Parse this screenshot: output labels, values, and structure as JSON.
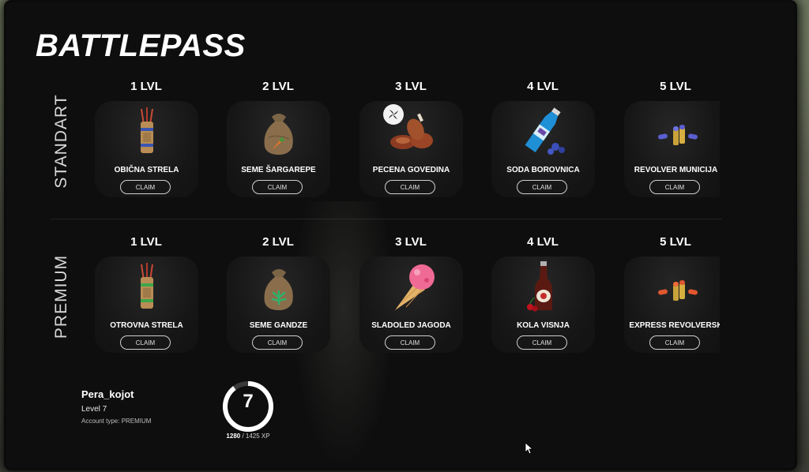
{
  "title": "BATTLEPASS",
  "rows": {
    "standart": {
      "label": "STANDART",
      "items": [
        {
          "level": "1 LVL",
          "name": "OBIČNA STRELA",
          "claim": "CLAIM",
          "icon": "arrow-quiver-icon"
        },
        {
          "level": "2 LVL",
          "name": "SEME ŠARGAREPE",
          "claim": "CLAIM",
          "icon": "carrot-seed-bag-icon"
        },
        {
          "level": "3 LVL",
          "name": "PECENA GOVEDINA",
          "claim": "CLAIM",
          "icon": "roast-meat-icon"
        },
        {
          "level": "4 LVL",
          "name": "SODA BOROVNICA",
          "claim": "CLAIM",
          "icon": "blueberry-soda-icon"
        },
        {
          "level": "5 LVL",
          "name": "REVOLVER MUNICIJA",
          "claim": "CLAIM",
          "icon": "revolver-ammo-icon"
        }
      ]
    },
    "premium": {
      "label": "PREMIUM",
      "items": [
        {
          "level": "1 LVL",
          "name": "OTROVNA STRELA",
          "claim": "CLAIM",
          "icon": "poison-arrow-quiver-icon"
        },
        {
          "level": "2 LVL",
          "name": "SEME GANDZE",
          "claim": "CLAIM",
          "icon": "cannabis-seed-bag-icon"
        },
        {
          "level": "3 LVL",
          "name": "SLADOLED JAGODA",
          "claim": "CLAIM",
          "icon": "strawberry-ice-cream-icon"
        },
        {
          "level": "4 LVL",
          "name": "KOLA VISNJA",
          "claim": "CLAIM",
          "icon": "cherry-cola-icon"
        },
        {
          "level": "5 LVL",
          "name": "EXPRESS REVOLVERSK",
          "claim": "CLAIM",
          "icon": "express-revolver-ammo-icon"
        }
      ]
    }
  },
  "player": {
    "name": "Pera_kojot",
    "level_text": "Level 7",
    "account_type_text": "Account type: PREMIUM"
  },
  "progress": {
    "level": "7",
    "xp_current": "1280",
    "xp_rest": " / 1425 XP",
    "fraction": 0.898
  },
  "colors": {
    "panel": "#0e0e0e",
    "text": "#ffffff",
    "badge": "#f3f3f3"
  }
}
